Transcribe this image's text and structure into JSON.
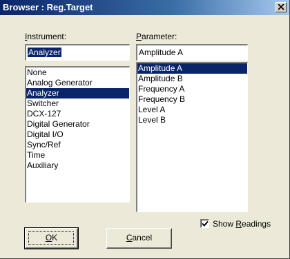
{
  "window": {
    "title": "Browser : Reg.Target",
    "close_icon": "close-icon"
  },
  "instrument": {
    "label_prefix": "",
    "label_mnemonic": "I",
    "label_rest": "nstrument:",
    "value": "Analyzer",
    "items": [
      "None",
      "Analog Generator",
      "Analyzer",
      "Switcher",
      "DCX-127",
      "Digital Generator",
      "Digital I/O",
      "Sync/Ref",
      "Time",
      "Auxiliary"
    ],
    "selected_index": 2
  },
  "parameter": {
    "label_prefix": "",
    "label_mnemonic": "P",
    "label_rest": "arameter:",
    "value": "Amplitude A",
    "items": [
      "Amplitude A",
      "Amplitude B",
      "Frequency A",
      "Frequency B",
      "Level A",
      "Level B"
    ],
    "selected_index": 0
  },
  "buttons": {
    "ok_mnemonic": "O",
    "ok_rest": "K",
    "cancel_mnemonic": "C",
    "cancel_rest": "ancel"
  },
  "show_readings": {
    "label_prefix": "Show ",
    "label_mnemonic": "R",
    "label_rest": "eadings",
    "checked": true
  },
  "colors": {
    "selection": "#0a246a",
    "face": "#ece9d8"
  }
}
